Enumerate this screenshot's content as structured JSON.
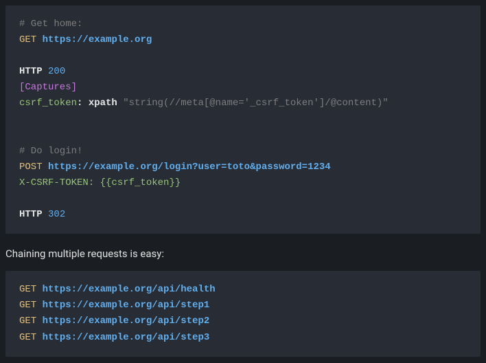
{
  "block1": {
    "comment1": "# Get home:",
    "method1": "GET",
    "url1": "https://example.org",
    "httpKw": "HTTP",
    "status1": "200",
    "section": "[Captures]",
    "capName": "csrf_token",
    "colon": ":",
    "queryKw": "xpath",
    "queryStr": "\"string(//meta[@name='_csrf_token']/@content)\"",
    "comment2": "# Do login!",
    "method2": "POST",
    "url2": "https://example.org/login?user=toto&password=1234",
    "headerName": "X-CSRF-TOKEN:",
    "headerVal": "{{csrf_token}}",
    "status2": "302"
  },
  "prose1": "Chaining multiple requests is easy:",
  "block2": {
    "m": "GET",
    "u1": "https://example.org/api/health",
    "u2": "https://example.org/api/step1",
    "u3": "https://example.org/api/step2",
    "u4": "https://example.org/api/step3"
  }
}
